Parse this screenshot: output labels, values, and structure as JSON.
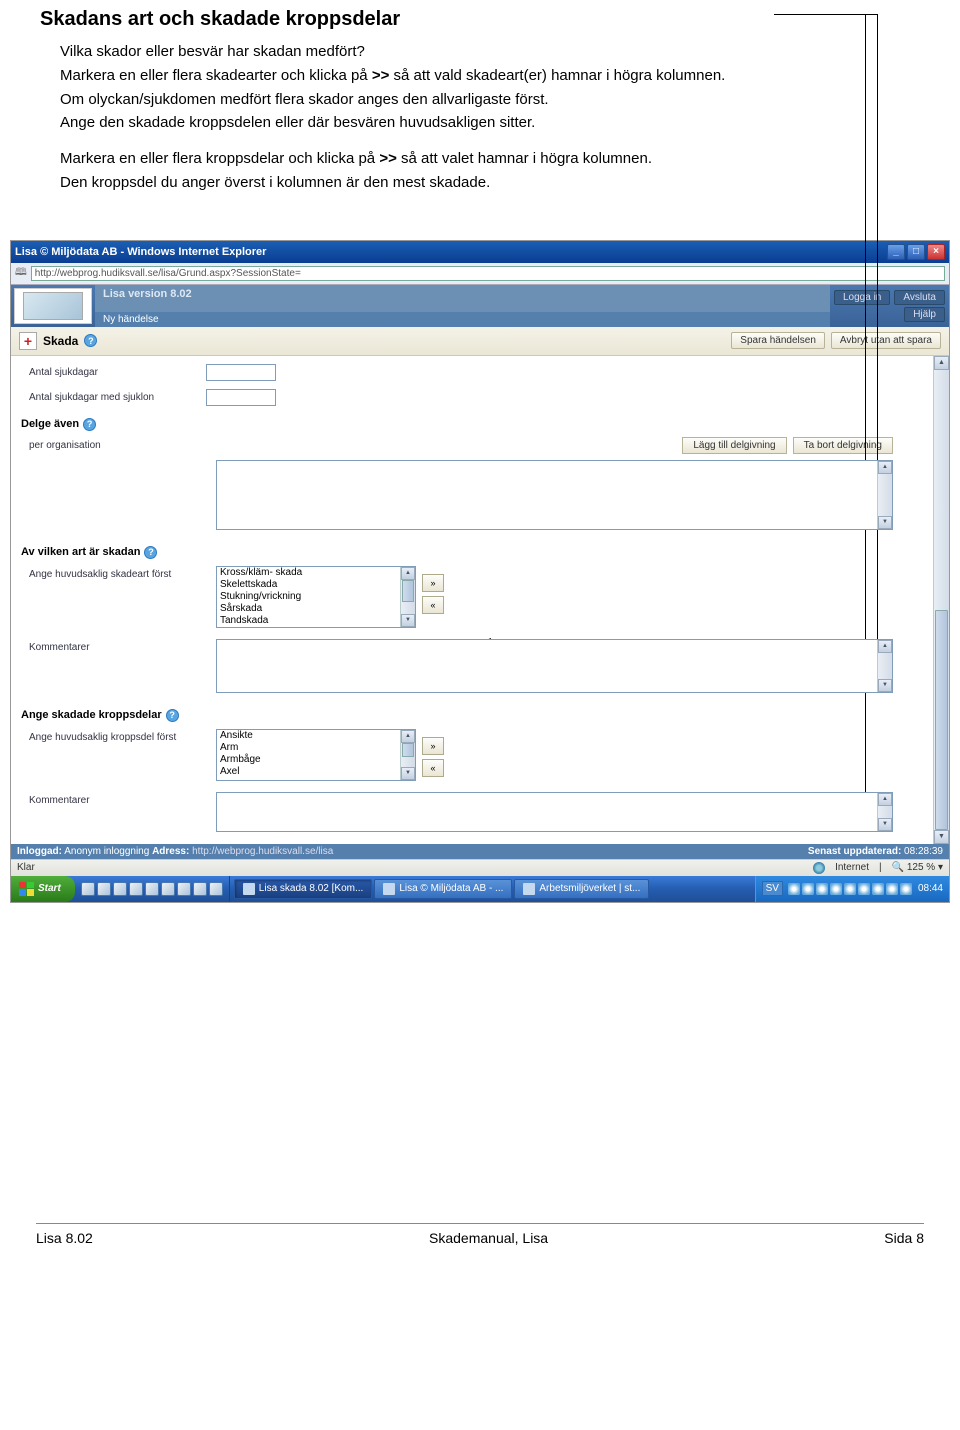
{
  "doc": {
    "heading": "Skadans art och skadade kroppsdelar",
    "p1": "Vilka skador eller besvär har skadan medfört?",
    "p2a": "Markera en eller flera skadearter och klicka på ",
    "p2b": ">>",
    "p2c": " så att vald skadeart(er) hamnar i högra kolumnen.",
    "p3": "Om olyckan/sjukdomen medfört flera skador anges den allvarligaste först.",
    "p4": "Ange den skadade kroppsdelen eller där besvären huvudsakligen sitter.",
    "p5a": "Markera en eller flera kroppsdelar och klicka på ",
    "p5b": ">>",
    "p5c": " så att valet hamnar i högra kolumnen.",
    "p6": "Den kroppsdel du anger överst i kolumnen är den mest skadade."
  },
  "ie": {
    "title": "Lisa © Miljödata AB - Windows Internet Explorer",
    "url": "http://webprog.hudiksvall.se/lisa/Grund.aspx?SessionState=",
    "status_left": "Klar",
    "status_zone": "Internet",
    "status_zoom": "125 %"
  },
  "lisa": {
    "version": "Lisa version 8.02",
    "sub": "Ny händelse",
    "login": "Logga in",
    "exit": "Avsluta",
    "help": "Hjälp"
  },
  "toolbar": {
    "title": "Skada",
    "save": "Spara händelsen",
    "cancel": "Avbryt utan att spara"
  },
  "form": {
    "sjukdagar": "Antal sjukdagar",
    "sjuklon": "Antal sjukdagar med sjuklon",
    "delge": "Delge även",
    "per_org": "per organisation",
    "lagg_till": "Lägg till delgivning",
    "ta_bort": "Ta bort delgivning",
    "art_head": "Av vilken art är skadan",
    "art_label": "Ange huvudsaklig skadeart först",
    "art_options": [
      "Kross/kläm- skada",
      "Skelettskada",
      "Stukning/vrickning",
      "Sårskada",
      "Tandskada"
    ],
    "kommentarer": "Kommentarer",
    "kropp_head": "Ange skadade kroppsdelar",
    "kropp_label": "Ange huvudsaklig kroppsdel först",
    "kropp_options": [
      "Ansikte",
      "Arm",
      "Armbåge",
      "Axel"
    ],
    "move_right": "»",
    "move_left": "«"
  },
  "status": {
    "in_label": "Inloggad:",
    "in_value": " Anonym inloggning  ",
    "addr_label": "Adress:",
    "addr_value": " http://webprog.hudiksvall.se/lisa",
    "upd_label": "Senast uppdaterad:",
    "upd_value": " 08:28:39"
  },
  "taskbar": {
    "start": "Start",
    "tasks": [
      "Lisa skada 8.02 [Kom...",
      "Lisa © Miljödata AB - ...",
      "Arbetsmiljöverket | st..."
    ],
    "lang": "SV",
    "clock": "08:44"
  },
  "footer": {
    "left": "Lisa 8.02",
    "center": "Skademanual, Lisa",
    "right": "Sida 8"
  }
}
